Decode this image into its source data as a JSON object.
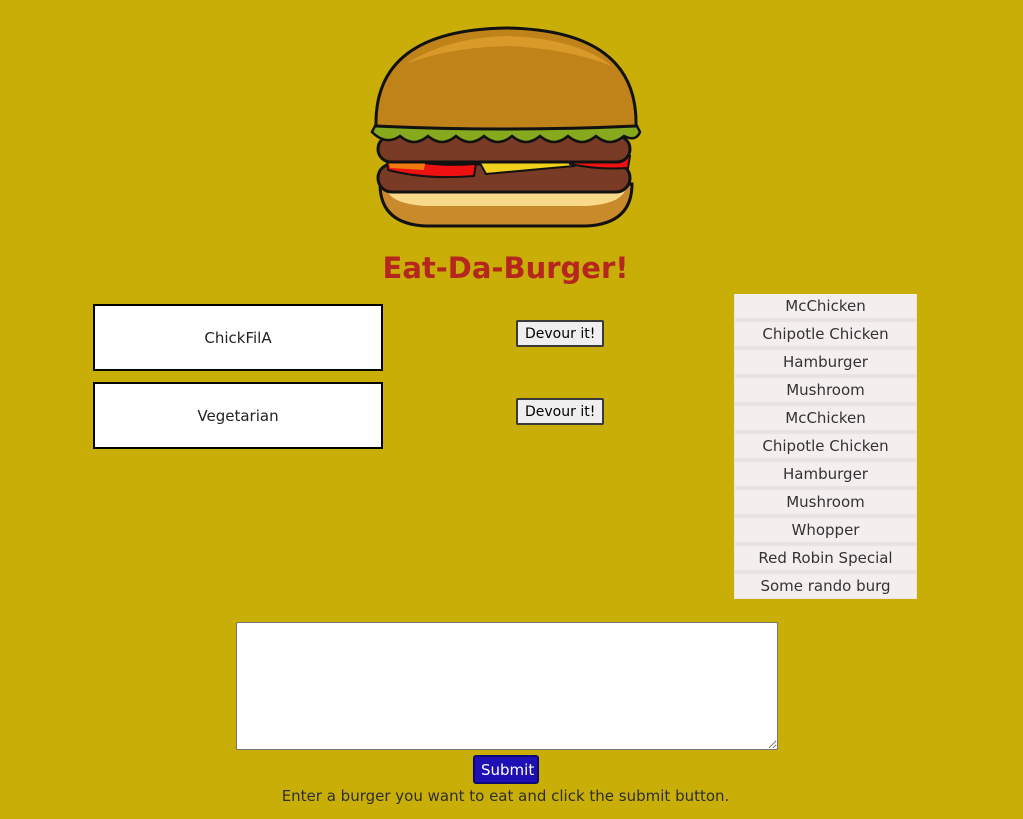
{
  "header": {
    "title": "Eat-Da-Burger!"
  },
  "uneaten_burgers": [
    {
      "name": "ChickFilA",
      "button_label": "Devour it!"
    },
    {
      "name": "Vegetarian",
      "button_label": "Devour it!"
    }
  ],
  "eaten_burgers": [
    "McChicken",
    "Chipotle Chicken",
    "Hamburger",
    "Mushroom",
    "McChicken",
    "Chipotle Chicken",
    "Hamburger",
    "Mushroom",
    "Whopper",
    "Red Robin Special",
    "Some rando burg"
  ],
  "form": {
    "input_value": "",
    "submit_label": "Submit",
    "instructions": "Enter a burger you want to eat and click the submit button."
  },
  "colors": {
    "background": "#c9ae07",
    "title": "#b5261f",
    "submit": "#1f10b5"
  },
  "icons": {
    "logo": "burger-logo-icon"
  }
}
